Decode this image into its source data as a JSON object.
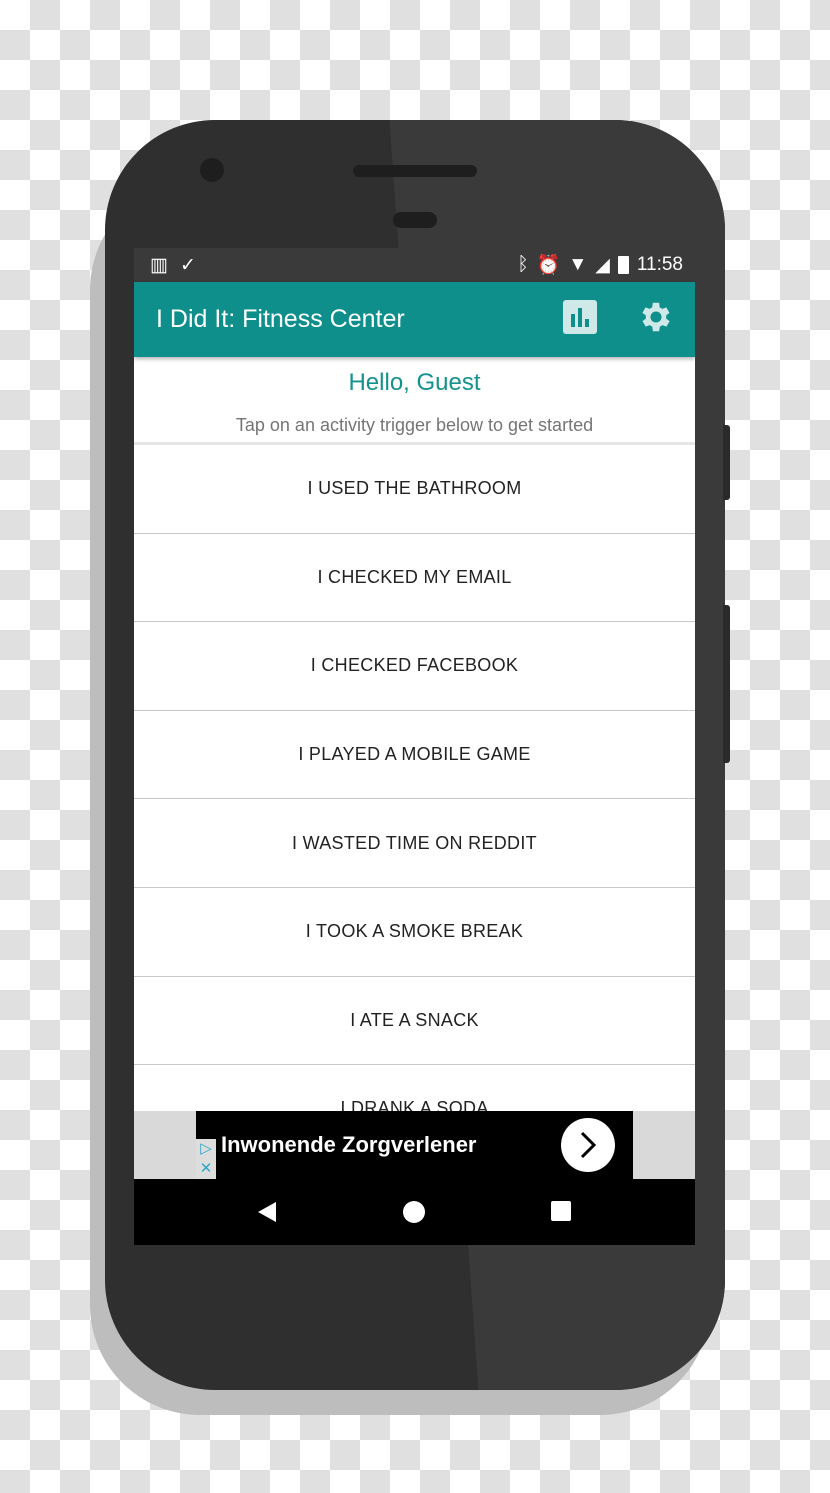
{
  "status_bar": {
    "time": "11:58",
    "left_icons": [
      "trello-icon",
      "briefcase-check-icon"
    ],
    "right_icons": [
      "bluetooth-icon",
      "alarm-icon",
      "wifi-icon",
      "signal-icon",
      "battery-icon"
    ]
  },
  "toolbar": {
    "title": "I Did It: Fitness Center",
    "actions": [
      "bar-chart-icon",
      "gear-icon"
    ],
    "color": "#0f8f8c"
  },
  "header": {
    "greeting": "Hello, Guest",
    "instruction": "Tap on an activity trigger below to get started"
  },
  "activities": [
    "I USED THE BATHROOM",
    "I CHECKED MY EMAIL",
    "I CHECKED FACEBOOK",
    "I PLAYED A MOBILE GAME",
    "I WASTED TIME ON REDDIT",
    "I TOOK A SMOKE BREAK",
    "I ATE A SNACK",
    "I DRANK A SODA"
  ],
  "ad": {
    "text": "Inwonende Zorgverlener"
  },
  "nav": [
    "back-icon",
    "home-icon",
    "recents-icon"
  ]
}
